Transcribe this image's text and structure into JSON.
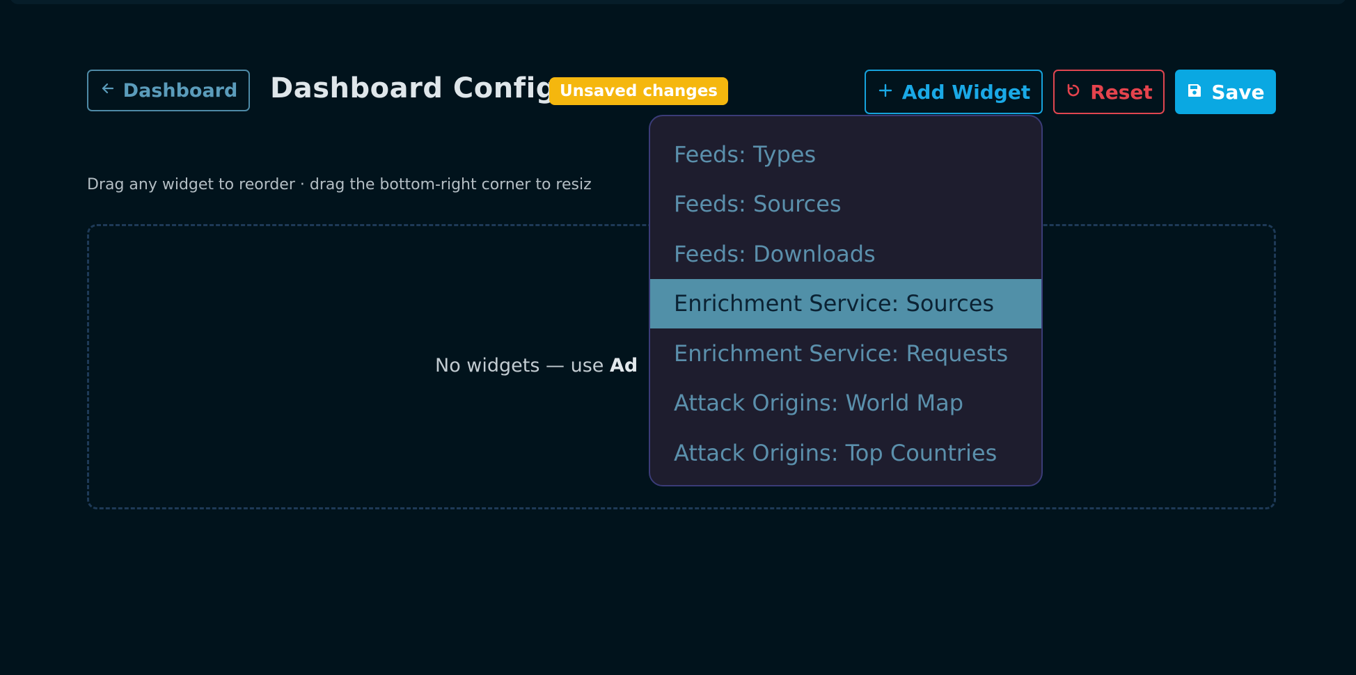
{
  "header": {
    "back_label": "Dashboard",
    "title": "Dashboard Config",
    "badge": "Unsaved changes",
    "add_widget_label": "Add Widget",
    "reset_label": "Reset",
    "save_label": "Save"
  },
  "hint": "Drag any widget to reorder · drag the bottom-right corner to resiz",
  "empty_state": {
    "prefix": "No widgets — use ",
    "bold": "Ad"
  },
  "dropdown": {
    "items": [
      {
        "label": "Feeds: Types"
      },
      {
        "label": "Feeds: Sources"
      },
      {
        "label": "Feeds: Downloads"
      },
      {
        "label": "Enrichment Service: Sources",
        "highlighted": true
      },
      {
        "label": "Enrichment Service: Requests"
      },
      {
        "label": "Attack Origins: World Map"
      },
      {
        "label": "Attack Origins: Top Countries"
      }
    ]
  },
  "colors": {
    "background": "#01131c",
    "badge": "#f5b70e",
    "accent": "#0aa8e2",
    "danger": "#e5434d",
    "dropdown_bg": "#1e1d2e",
    "highlight": "#5190a8"
  },
  "icons": {
    "back": "arrow-left-icon",
    "add": "plus-icon",
    "reset": "refresh-icon",
    "save": "floppy-disk-icon"
  }
}
